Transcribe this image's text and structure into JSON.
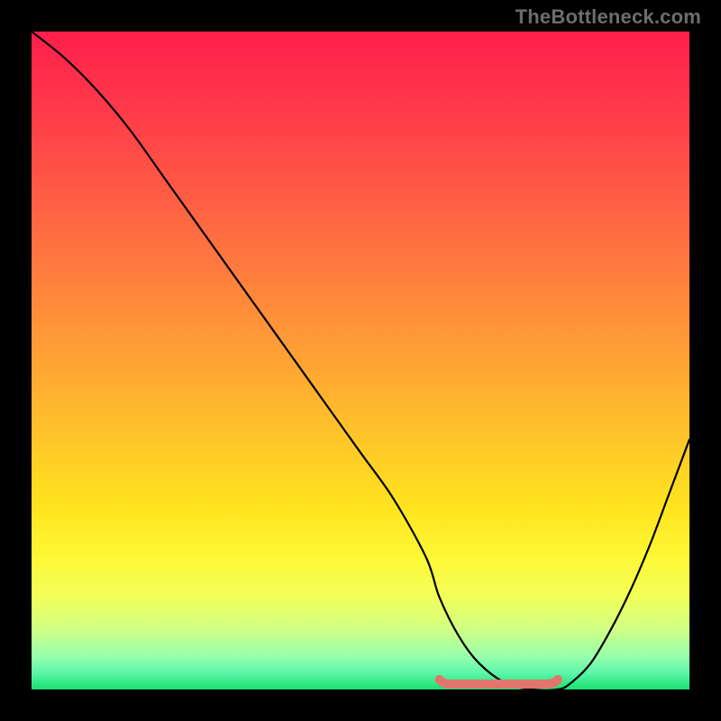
{
  "watermark": "TheBottleneck.com",
  "chart_data": {
    "type": "line",
    "title": "",
    "xlabel": "",
    "ylabel": "",
    "xlim": [
      0,
      100
    ],
    "ylim": [
      0,
      100
    ],
    "grid": false,
    "legend": false,
    "annotations": [],
    "series": [
      {
        "name": "bottleneck-curve",
        "color": "#000000",
        "x": [
          0,
          5,
          10,
          15,
          20,
          25,
          30,
          35,
          40,
          45,
          50,
          55,
          60,
          62,
          65,
          68,
          72,
          76,
          80,
          82,
          85,
          88,
          91,
          94,
          97,
          100
        ],
        "y": [
          100,
          96,
          91,
          85,
          78,
          71,
          64,
          57,
          50,
          43,
          36,
          29,
          20,
          14,
          8,
          4,
          1,
          0,
          0,
          1,
          4,
          9,
          15,
          22,
          30,
          38
        ]
      },
      {
        "name": "optimal-band",
        "color": "#e2766e",
        "x": [
          62,
          80
        ],
        "y": [
          0,
          0
        ]
      }
    ],
    "gradient_stops": [
      {
        "offset": 0.0,
        "color": "#ff1f4b"
      },
      {
        "offset": 0.12,
        "color": "#ff3a4a"
      },
      {
        "offset": 0.24,
        "color": "#ff5a45"
      },
      {
        "offset": 0.36,
        "color": "#ff7b3e"
      },
      {
        "offset": 0.48,
        "color": "#ff9d35"
      },
      {
        "offset": 0.6,
        "color": "#ffc02a"
      },
      {
        "offset": 0.72,
        "color": "#ffe31e"
      },
      {
        "offset": 0.8,
        "color": "#fef836"
      },
      {
        "offset": 0.86,
        "color": "#f2ff5a"
      },
      {
        "offset": 0.91,
        "color": "#ceff85"
      },
      {
        "offset": 0.95,
        "color": "#97ffad"
      },
      {
        "offset": 0.975,
        "color": "#5cf6a8"
      },
      {
        "offset": 1.0,
        "color": "#19e06f"
      }
    ]
  }
}
